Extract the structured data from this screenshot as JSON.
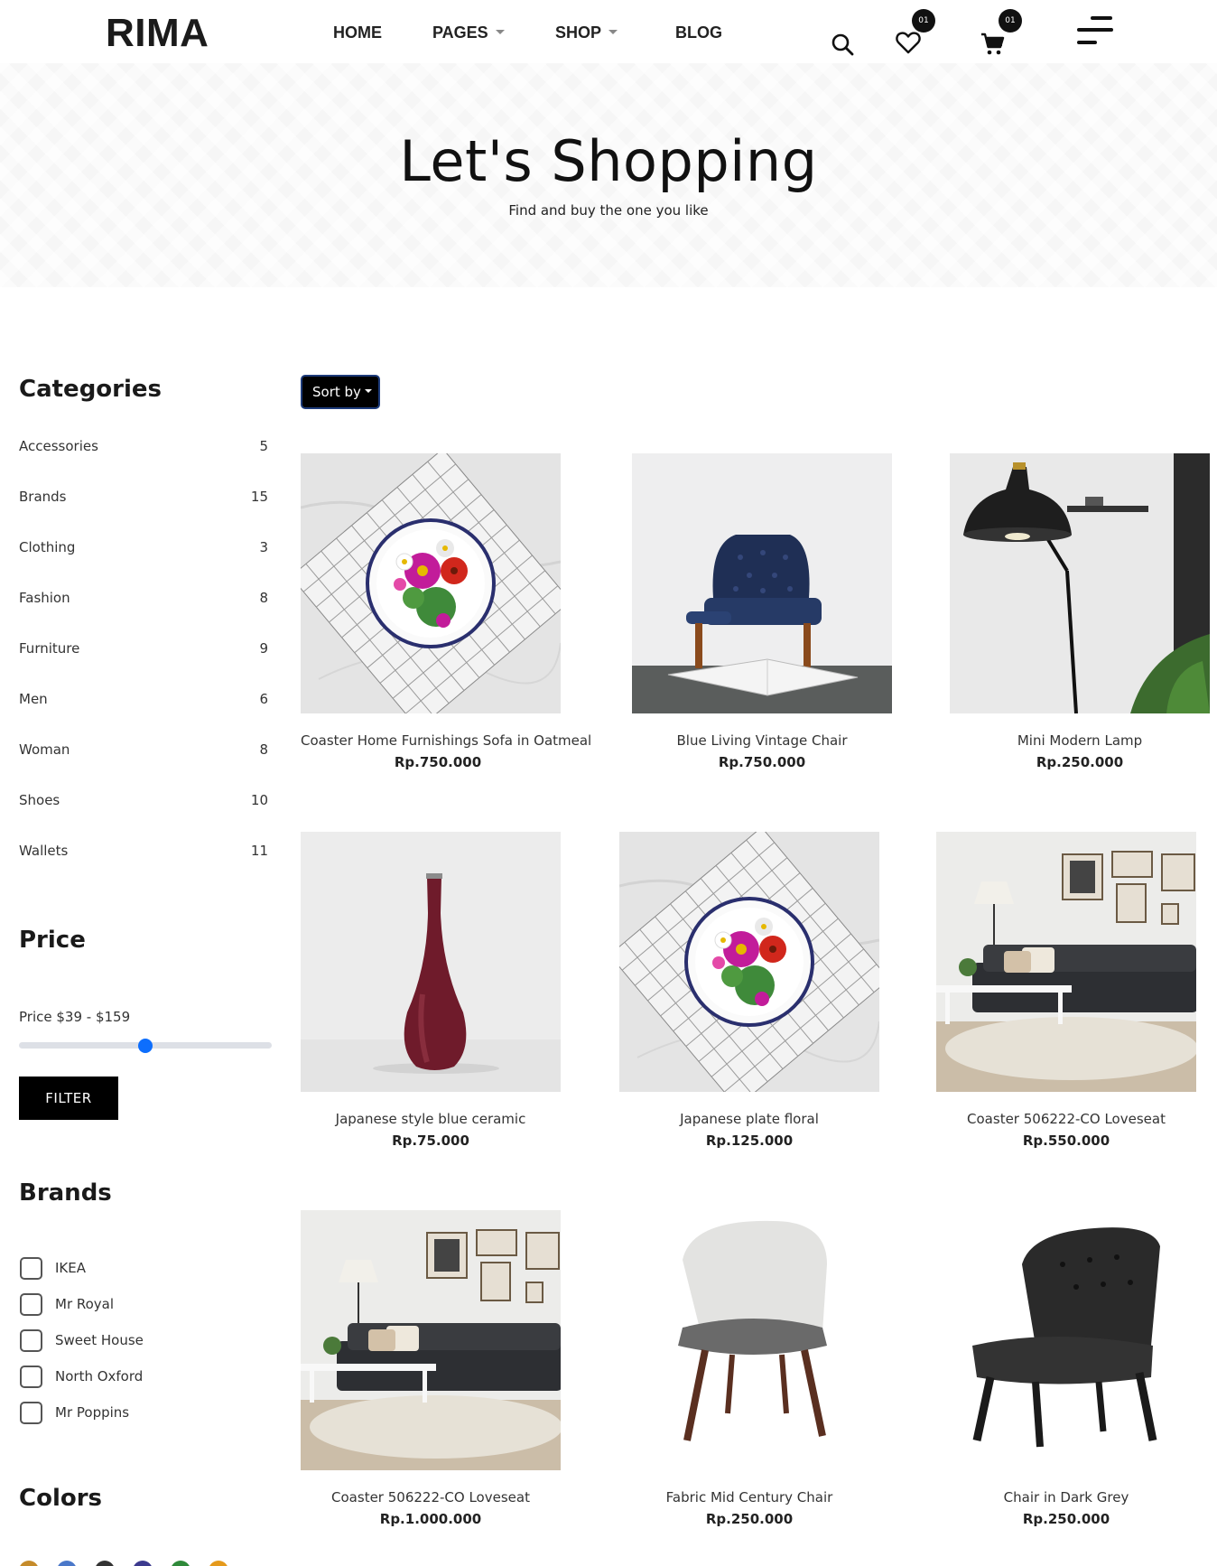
{
  "header": {
    "logo": "RIMA",
    "nav": [
      {
        "label": "HOME"
      },
      {
        "label": "PAGES"
      },
      {
        "label": "SHOP"
      },
      {
        "label": "BLOG"
      }
    ],
    "icons": {
      "search": "search-icon",
      "wishlist": "heart-icon",
      "cart": "cart-icon",
      "menu": "menu-icon"
    },
    "wishlist_count": "01",
    "cart_count": "01"
  },
  "hero": {
    "title": "Let's Shopping",
    "subtitle": "Find and buy the one you like"
  },
  "sidebar": {
    "categories_heading": "Categories",
    "categories": [
      {
        "name": "Accessories",
        "count": "5"
      },
      {
        "name": "Brands",
        "count": "15"
      },
      {
        "name": "Clothing",
        "count": "3"
      },
      {
        "name": "Fashion",
        "count": "8"
      },
      {
        "name": "Furniture",
        "count": "9"
      },
      {
        "name": "Men",
        "count": "6"
      },
      {
        "name": "Woman",
        "count": "8"
      },
      {
        "name": "Shoes",
        "count": "10"
      },
      {
        "name": "Wallets",
        "count": "11"
      }
    ],
    "price_heading": "Price",
    "price_label": "Price $39 - $159",
    "price_slider_value": 0.5,
    "filter_label": "FILTER",
    "brands_heading": "Brands",
    "brands": [
      {
        "name": "IKEA",
        "checked": false
      },
      {
        "name": "Mr Royal",
        "checked": false
      },
      {
        "name": "Sweet House",
        "checked": false
      },
      {
        "name": "North Oxford",
        "checked": false
      },
      {
        "name": "Mr Poppins",
        "checked": false
      }
    ],
    "colors_heading": "Colors",
    "colors": [
      "#c58b2a",
      "#4a78c9",
      "#333333",
      "#3c3a8e",
      "#2f8a3a",
      "#e59a1c"
    ]
  },
  "sort": {
    "label": "Sort by"
  },
  "products": [
    {
      "name": "Coaster Home Furnishings Sofa in Oatmeal",
      "price": "Rp.750.000",
      "image": "floral-plate"
    },
    {
      "name": "Blue Living Vintage Chair",
      "price": "Rp.750.000",
      "image": "blue-chair"
    },
    {
      "name": "Mini Modern Lamp",
      "price": "Rp.250.000",
      "image": "floor-lamp"
    },
    {
      "name": "Japanese style blue ceramic",
      "price": "Rp.75.000",
      "image": "red-vase"
    },
    {
      "name": "Japanese plate floral",
      "price": "Rp.125.000",
      "image": "floral-plate"
    },
    {
      "name": "Coaster 506222-CO Loveseat",
      "price": "Rp.550.000",
      "image": "living-room"
    },
    {
      "name": "Coaster 506222-CO Loveseat",
      "price": "Rp.1.000.000",
      "image": "living-room"
    },
    {
      "name": "Fabric Mid Century Chair",
      "price": "Rp.250.000",
      "image": "grey-chair"
    },
    {
      "name": "Chair in Dark Grey",
      "price": "Rp.250.000",
      "image": "dark-chair"
    }
  ]
}
